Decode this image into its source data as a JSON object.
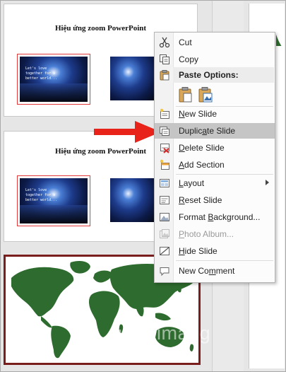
{
  "slides": [
    {
      "title": "Hiệu ứng zoom PowerPoint",
      "caption_lines": [
        "Let's love",
        "together for a",
        "better world..."
      ]
    },
    {
      "title": "Hiệu ứng zoom PowerPoint",
      "caption_lines": [
        "Let's love",
        "together for a",
        "better world..."
      ]
    }
  ],
  "context_menu": {
    "items": [
      {
        "label": "Cut",
        "icon": "scissors-icon",
        "enabled": true
      },
      {
        "label": "Copy",
        "icon": "copy-icon",
        "enabled": true
      },
      {
        "label": "Paste Options:",
        "icon": "clipboard-icon",
        "enabled": true
      },
      {
        "label": "New Slide",
        "icon": "new-slide-icon",
        "enabled": true
      },
      {
        "label": "Duplicate Slide",
        "icon": "duplicate-slide-icon",
        "enabled": true,
        "highlighted": true
      },
      {
        "label": "Delete Slide",
        "icon": "delete-slide-icon",
        "enabled": true
      },
      {
        "label": "Add Section",
        "icon": "add-section-icon",
        "enabled": true
      },
      {
        "label": "Layout",
        "icon": "layout-icon",
        "enabled": true,
        "submenu": true
      },
      {
        "label": "Reset Slide",
        "icon": "reset-slide-icon",
        "enabled": true
      },
      {
        "label": "Format Background...",
        "icon": "format-background-icon",
        "enabled": true
      },
      {
        "label": "Photo Album...",
        "icon": "photo-album-icon",
        "enabled": false
      },
      {
        "label": "Hide Slide",
        "icon": "hide-slide-icon",
        "enabled": true
      },
      {
        "label": "New Comment",
        "icon": "comment-icon",
        "enabled": true
      }
    ]
  },
  "watermark": "uantrimang",
  "colors": {
    "accent_red": "#e8231a",
    "map_green": "#2e6b2e",
    "selected_border": "#7a1d1d"
  }
}
